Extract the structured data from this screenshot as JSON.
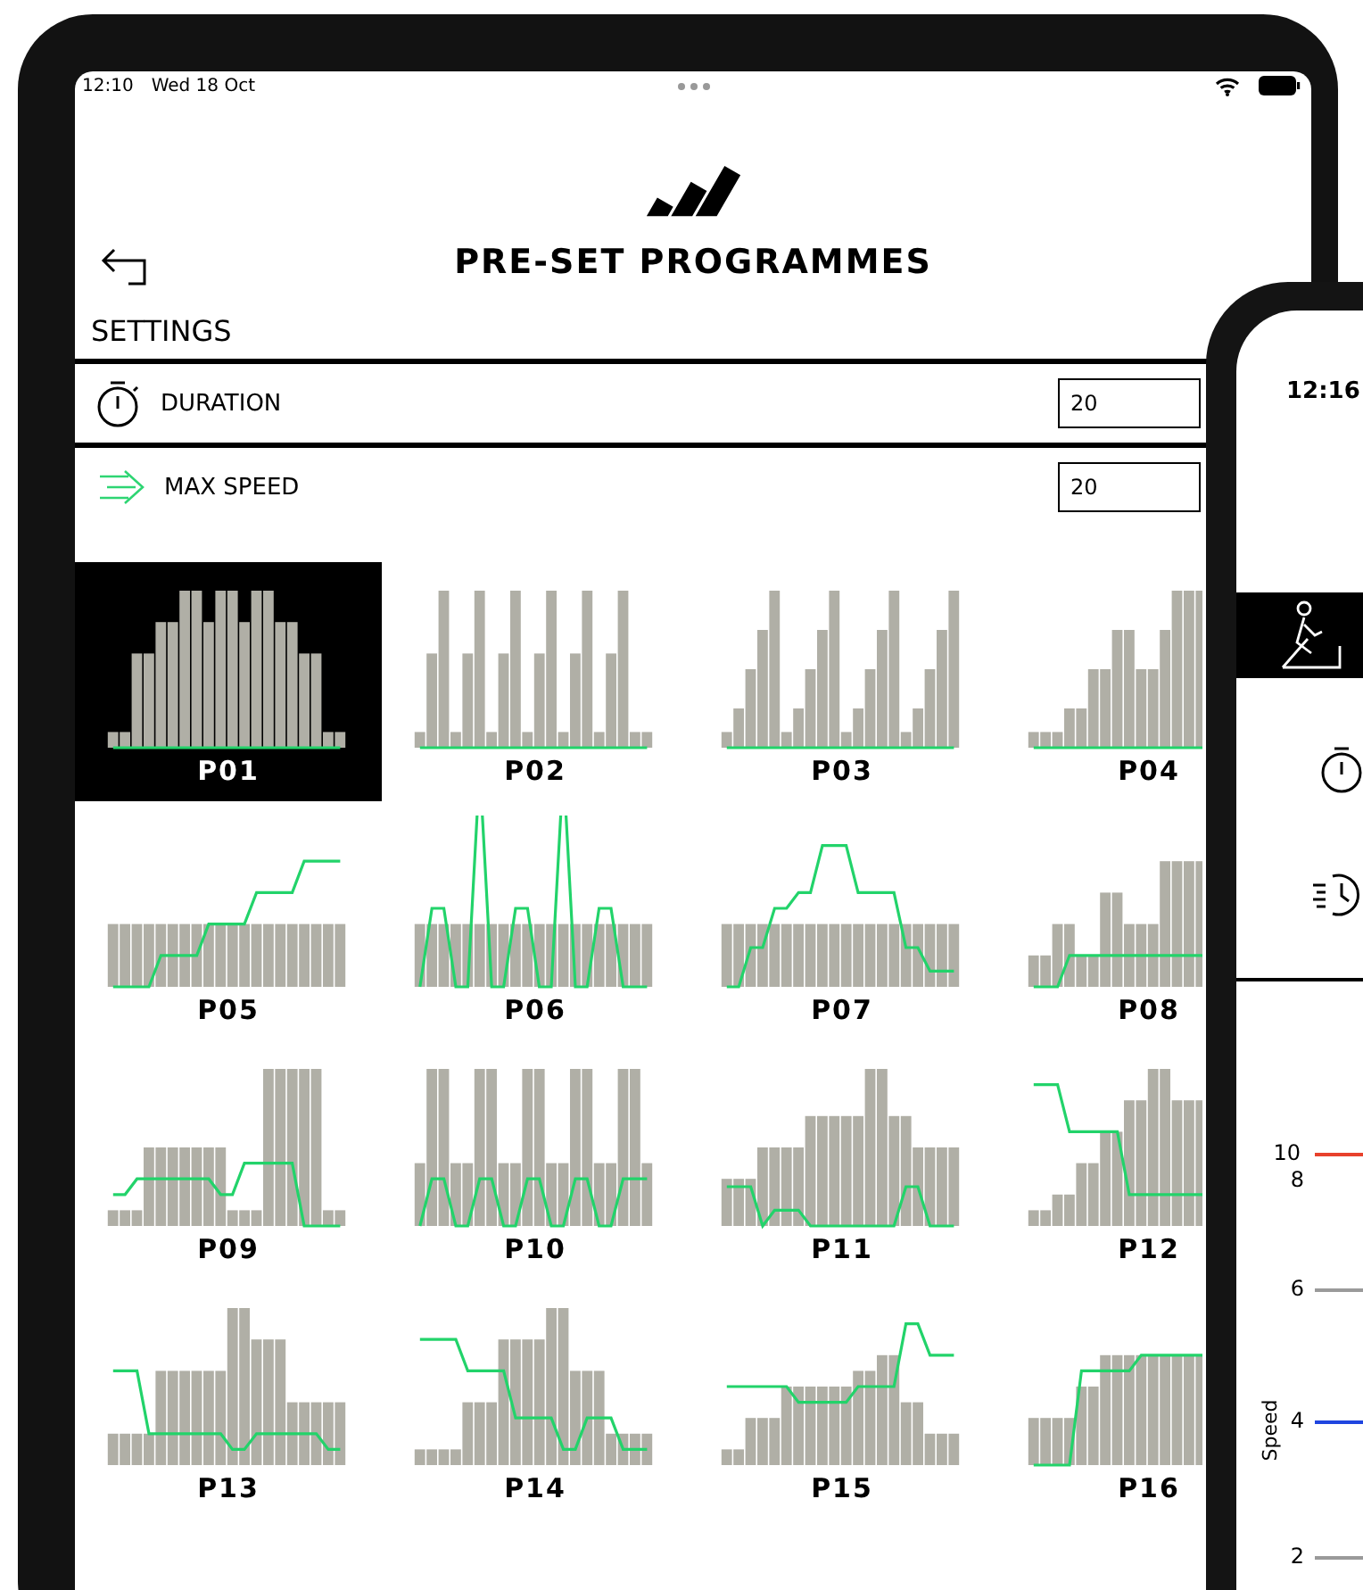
{
  "status_bar": {
    "time": "12:10",
    "date": "Wed 18 Oct"
  },
  "header": {
    "title": "PRE-SET PROGRAMMES"
  },
  "settings": {
    "heading": "SETTINGS",
    "rows": [
      {
        "kind": "duration",
        "label": "DURATION",
        "value": "20"
      },
      {
        "kind": "speed",
        "label": "MAX SPEED",
        "value": "20"
      }
    ]
  },
  "programmes": [
    {
      "label": "P01",
      "selected": true
    },
    {
      "label": "P02",
      "selected": false
    },
    {
      "label": "P03",
      "selected": false
    },
    {
      "label": "P04",
      "selected": false
    },
    {
      "label": "P05",
      "selected": false
    },
    {
      "label": "P06",
      "selected": false
    },
    {
      "label": "P07",
      "selected": false
    },
    {
      "label": "P08",
      "selected": false
    },
    {
      "label": "P09",
      "selected": false
    },
    {
      "label": "P10",
      "selected": false
    },
    {
      "label": "P11",
      "selected": false
    },
    {
      "label": "P12",
      "selected": false
    },
    {
      "label": "P13",
      "selected": false
    },
    {
      "label": "P14",
      "selected": false
    },
    {
      "label": "P15",
      "selected": false
    },
    {
      "label": "P16",
      "selected": false
    }
  ],
  "phone": {
    "time": "12:16",
    "axis_title": "Speed",
    "axis_labels": [
      {
        "label": "10",
        "color": "#e8412c"
      },
      {
        "label": "8"
      },
      {
        "label": "6",
        "color": "#9a9a9a"
      },
      {
        "label": "4",
        "color": "#1f45e0"
      },
      {
        "label": "2",
        "color": "#9a9a9a"
      }
    ]
  }
}
